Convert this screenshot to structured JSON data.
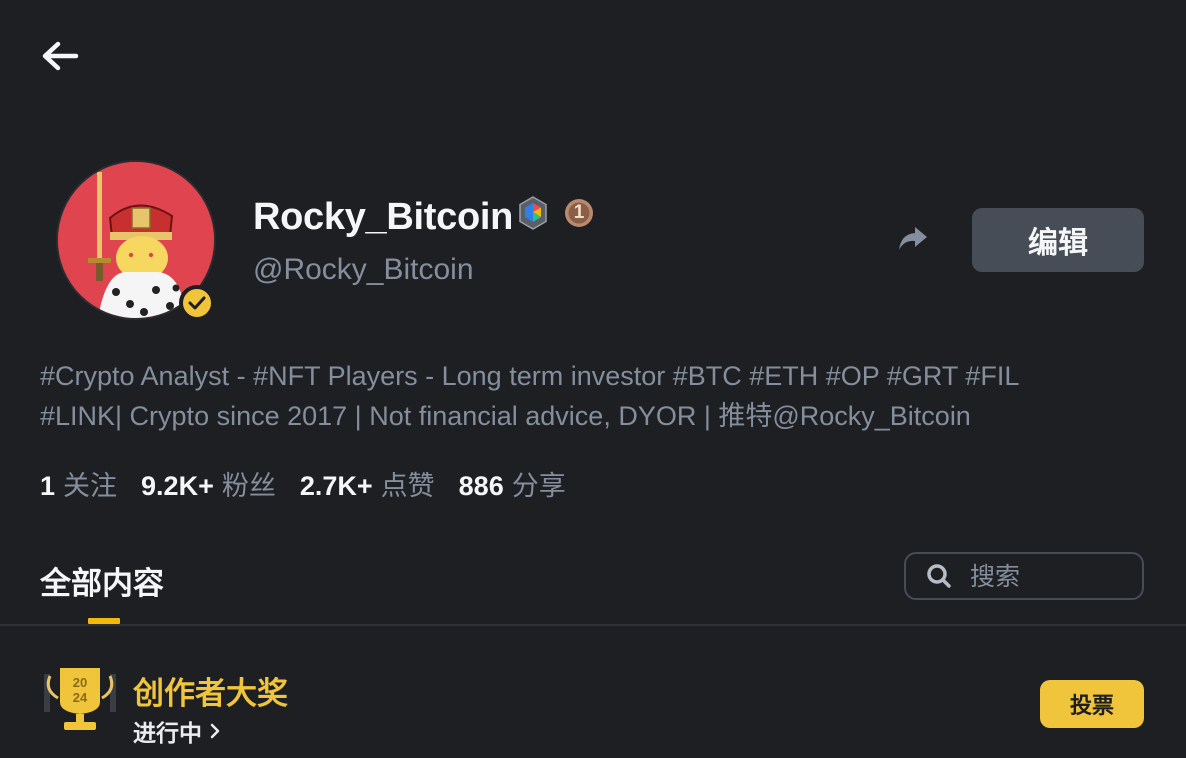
{
  "profile": {
    "display_name": "Rocky_Bitcoin",
    "handle": "@Rocky_Bitcoin",
    "rank_badge": "1",
    "bio_line1": "#Crypto Analyst - #NFT Players - Long term investor #BTC #ETH #OP #GRT #FIL",
    "bio_line2": "#LINK| Crypto since 2017 | Not financial advice, DYOR | 推特@Rocky_Bitcoin"
  },
  "actions": {
    "edit_label": "编辑",
    "vote_label": "投票"
  },
  "stats": [
    {
      "value": "1",
      "label": "关注"
    },
    {
      "value": "9.2K+",
      "label": "粉丝"
    },
    {
      "value": "2.7K+",
      "label": "点赞"
    },
    {
      "value": "886",
      "label": "分享"
    }
  ],
  "tabs": {
    "all_label": "全部内容"
  },
  "search": {
    "placeholder": "搜索"
  },
  "award": {
    "title": "创作者大奖",
    "status": "进行中",
    "year_top": "20",
    "year_bottom": "24"
  },
  "colors": {
    "background": "#1e1f23",
    "accent_yellow": "#f0c53c",
    "secondary_text": "#848e9c",
    "button_gray": "#474d57"
  },
  "icons": [
    "back-arrow-icon",
    "verified-icon",
    "rainbow-hexagon-icon",
    "rank-medal-icon",
    "share-icon",
    "search-icon",
    "trophy-icon",
    "chevron-right-icon"
  ]
}
